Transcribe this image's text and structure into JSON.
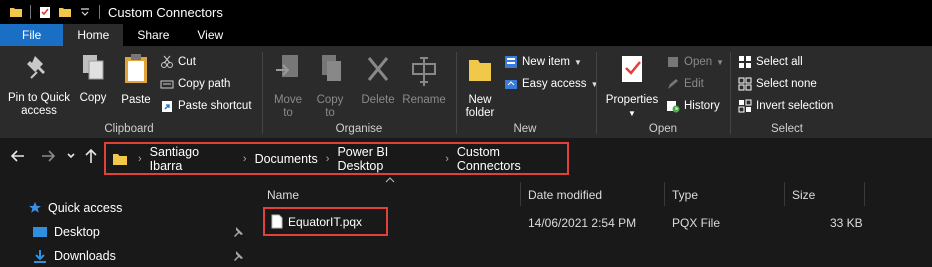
{
  "window": {
    "title": "Custom Connectors"
  },
  "tabs": [
    {
      "label": "File"
    },
    {
      "label": "Home"
    },
    {
      "label": "Share"
    },
    {
      "label": "View"
    }
  ],
  "ribbon": {
    "clipboard": {
      "label": "Clipboard",
      "pin_label_1": "Pin to Quick",
      "pin_label_2": "access",
      "copy": "Copy",
      "paste": "Paste",
      "cut": "Cut",
      "copy_path": "Copy path",
      "paste_shortcut": "Paste shortcut"
    },
    "organise": {
      "label": "Organise",
      "move_1": "Move",
      "move_2": "to",
      "copy_1": "Copy",
      "copy_2": "to",
      "delete": "Delete",
      "rename": "Rename"
    },
    "new": {
      "label": "New",
      "new_folder_1": "New",
      "new_folder_2": "folder",
      "new_item": "New item",
      "easy_access": "Easy access"
    },
    "open": {
      "label": "Open",
      "properties": "Properties",
      "open": "Open",
      "edit": "Edit",
      "history": "History"
    },
    "select": {
      "label": "Select",
      "select_all": "Select all",
      "select_none": "Select none",
      "invert_selection": "Invert selection"
    }
  },
  "address": {
    "crumbs": [
      "Santiago Ibarra",
      "Documents",
      "Power BI Desktop",
      "Custom Connectors"
    ]
  },
  "navpane": {
    "items": [
      {
        "label": "Quick access",
        "icon": "star-icon"
      },
      {
        "label": "Desktop",
        "icon": "desktop-icon"
      },
      {
        "label": "Downloads",
        "icon": "download-icon"
      }
    ]
  },
  "files": {
    "columns": [
      "Name",
      "Date modified",
      "Type",
      "Size"
    ],
    "rows": [
      {
        "name": "EquatorIT.pqx",
        "date": "14/06/2021 2:54 PM",
        "type": "PQX File",
        "size": "33 KB"
      }
    ]
  },
  "colors": {
    "accent": "#1a6fc4",
    "highlight": "#e0413b",
    "folder": "#f2c84b"
  }
}
